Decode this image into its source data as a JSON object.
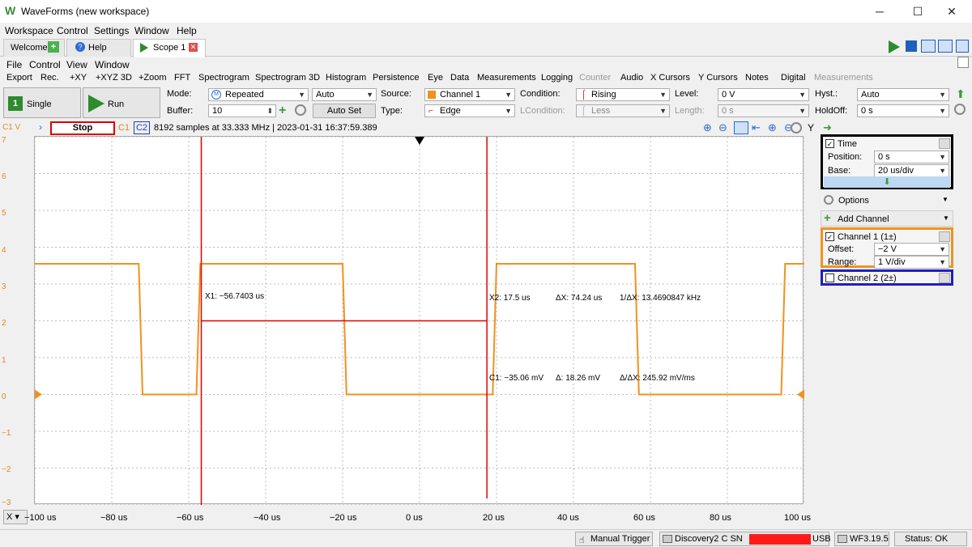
{
  "window": {
    "title": "WaveForms (new workspace)",
    "minimize": "─",
    "maximize": "☐",
    "close": "✕"
  },
  "menu": [
    "Workspace",
    "Control",
    "Settings",
    "Window",
    "Help"
  ],
  "tabs": [
    {
      "label": "Welcome"
    },
    {
      "label": "Help"
    },
    {
      "label": "Scope 1"
    }
  ],
  "submenu": [
    "File",
    "Control",
    "View",
    "Window"
  ],
  "toolbar": [
    "Export",
    "Rec.",
    "+XY",
    "+XYZ 3D",
    "+Zoom",
    "FFT",
    "Spectrogram",
    "Spectrogram 3D",
    "Histogram",
    "Persistence",
    "Eye",
    "Data",
    "Measurements",
    "Logging",
    "Counter",
    "Audio",
    "X Cursors",
    "Y Cursors",
    "Notes",
    "Digital",
    "Measurements"
  ],
  "controls": {
    "single": "Single",
    "single_num": "1",
    "run": "Run",
    "mode_label": "Mode:",
    "mode_value": "Repeated",
    "mode_auto": "Auto",
    "buffer_label": "Buffer:",
    "buffer_value": "10",
    "autoset": "Auto Set",
    "source_label": "Source:",
    "source_value": "Channel 1",
    "type_label": "Type:",
    "type_value": "Edge",
    "condition_label": "Condition:",
    "condition_value": "Rising",
    "lcondition_label": "LCondition:",
    "lcondition_value": "Less",
    "level_label": "Level:",
    "level_value": "0 V",
    "length_label": "Length:",
    "length_value": "0 s",
    "hyst_label": "Hyst.:",
    "hyst_value": "Auto",
    "holdoff_label": "HoldOff:",
    "holdoff_value": "0 s"
  },
  "status": {
    "c1v": "C1 V",
    "stop": "Stop",
    "c1": "C1",
    "c2": "C2",
    "info": "8192 samples at 33.333 MHz | 2023-01-31 16:37:59.389",
    "y": "Y"
  },
  "plot": {
    "y_ticks": [
      "7",
      "6",
      "5",
      "4",
      "3",
      "2",
      "1",
      "0",
      "−1",
      "−2",
      "−3"
    ],
    "x_ticks": [
      "−100 us",
      "−80 us",
      "−60 us",
      "−40 us",
      "−20 us",
      "0 us",
      "20 us",
      "40 us",
      "60 us",
      "80 us",
      "100 us"
    ],
    "x_axis_btn": "X",
    "cursor_x1": "X1: −56.7403 us",
    "cursor_x2": "X2: 17.5 us",
    "delta_x": "ΔX: 74.24 us",
    "inv_delta_x": "1/ΔX: 13.4690847 kHz",
    "cursor_c1": "C1: −35.06 mV",
    "delta_y": "Δ: 18.26 mV",
    "delta_ratio": "Δ/ΔX: 245.92 mV/ms"
  },
  "chart_data": {
    "type": "line",
    "series": [
      {
        "name": "",
        "x": [
          -100,
          -73,
          -72,
          -58,
          -57,
          -20,
          -19,
          19,
          20,
          56,
          57,
          94,
          95,
          100
        ],
        "y": [
          3.55,
          3.55,
          0,
          0,
          3.55,
          3.55,
          0,
          0,
          3.55,
          3.55,
          0,
          0,
          3.55,
          3.55
        ]
      }
    ],
    "xlim": [
      -100,
      100
    ],
    "ylim": [
      -3,
      7
    ],
    "grid": true,
    "trace_color": "#f0921e",
    "cursor_color": "#e00000"
  },
  "rpanel": {
    "time": "Time",
    "position_label": "Position:",
    "position_value": "0 s",
    "base_label": "Base:",
    "base_value": "20 us/div",
    "options": "Options",
    "add_channel": "Add Channel",
    "ch1": "Channel 1 (1±)",
    "offset_label": "Offset:",
    "offset_value": "−2 V",
    "range_label": "Range:",
    "range_value": "1 V/div",
    "ch2": "Channel 2 (2±)"
  },
  "bottom": {
    "manual_trigger": "Manual Trigger",
    "device": "Discovery2 C SN",
    "usb": "USB",
    "version": "WF3.19.5",
    "status": "Status: OK"
  }
}
